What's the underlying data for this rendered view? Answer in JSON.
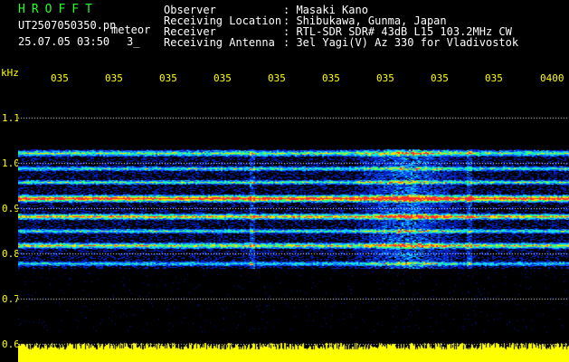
{
  "header": {
    "app_title": "HROFFT",
    "file_name": "UT2507050350.pn",
    "meteor_label": "meteor",
    "datetime": "25.07.05 03:50",
    "count": "3_",
    "info": [
      {
        "key": "Observer",
        "value": ": Masaki Kano"
      },
      {
        "key": "Receiving Location",
        "value": ": Shibukawa, Gunma, Japan"
      },
      {
        "key": "Receiver",
        "value": ": RTL-SDR SDR# 43dB L15 103.2MHz CW"
      },
      {
        "key": "Receiving Antenna",
        "value": ": 3el Yagi(V) Az 330 for Vladivostok"
      }
    ]
  },
  "axes": {
    "y_unit": "kHz",
    "y_ticks": [
      "1.1",
      "1.0",
      "0.9",
      "0.8",
      "0.7",
      "0.6"
    ],
    "x_ticks": [
      "035",
      "035",
      "035",
      "035",
      "035",
      "035",
      "035",
      "035",
      "035",
      "0400"
    ]
  },
  "colors": {
    "background": "#000000",
    "axis_text": "#ffff00",
    "title": "#22ff22",
    "noise_bar": "#ffff00",
    "grid": "#ffffff"
  }
}
